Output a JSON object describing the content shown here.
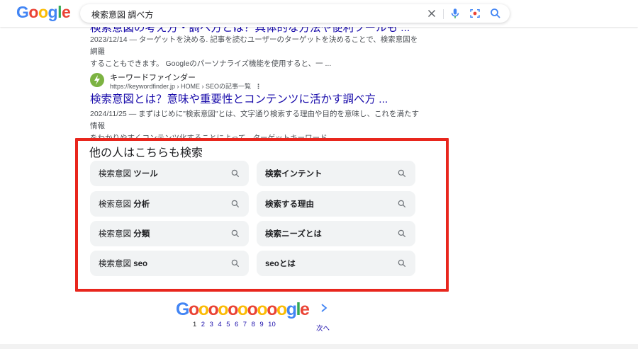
{
  "header": {
    "logo_letters": [
      {
        "ch": "G",
        "color": "#4285f4"
      },
      {
        "ch": "o",
        "color": "#ea4335"
      },
      {
        "ch": "o",
        "color": "#fbbc05"
      },
      {
        "ch": "g",
        "color": "#4285f4"
      },
      {
        "ch": "l",
        "color": "#34a853"
      },
      {
        "ch": "e",
        "color": "#ea4335"
      }
    ],
    "search_query": "検索意図 調べ方",
    "icons": [
      "clear-icon",
      "microphone-icon",
      "lens-camera-icon",
      "search-icon"
    ]
  },
  "results": [
    {
      "title": "検索意図の考え方・調べ方とは？具体的な方法や便利ツールも ...",
      "date": "2023/12/14",
      "snippet_line1": "2023/12/14 — ターゲットを決める. 記事を読むユーザーのターゲットを決めることで、検索意図を網羅",
      "snippet_line2": "することもできます。 Googleのパーソナライズ機能を使用すると、一 ..."
    },
    {
      "site_name": "キーワードファインダー",
      "site_url": "https://keywordfinder.jp › HOME › SEOの記事一覧",
      "title": "検索意図とは？意味や重要性とコンテンツに活かす調べ方 ...",
      "snippet_line1": "2024/11/25 — まずはじめに\"検索意図\"とは、文字通り検索する理由や目的を意味し、これを満たす情報",
      "snippet_line2": "をわかりやすくコンテンツ化することによって、ターゲットキーワード ..."
    }
  ],
  "related": {
    "title": "他の人はこちらも検索",
    "items": [
      {
        "prefix": "検索意図 ",
        "bold": "ツール"
      },
      {
        "prefix": "",
        "bold": "検索インテント"
      },
      {
        "prefix": "検索意図 ",
        "bold": "分析"
      },
      {
        "prefix": "",
        "bold": "検索する理由"
      },
      {
        "prefix": "検索意図 ",
        "bold": "分類"
      },
      {
        "prefix": "",
        "bold": "検索ニーズとは"
      },
      {
        "prefix": "検索意図 ",
        "bold": "seo"
      },
      {
        "prefix": "",
        "bold": "seoとは"
      }
    ]
  },
  "pagination": {
    "logo": "Goooooooooogle",
    "pages": [
      "1",
      "2",
      "3",
      "4",
      "5",
      "6",
      "7",
      "8",
      "9",
      "10"
    ],
    "current": "1",
    "next_label": "次へ"
  },
  "colors": {
    "highlight_border": "#e8261d",
    "link": "#1a0dab",
    "chip_bg": "#f1f3f4"
  }
}
